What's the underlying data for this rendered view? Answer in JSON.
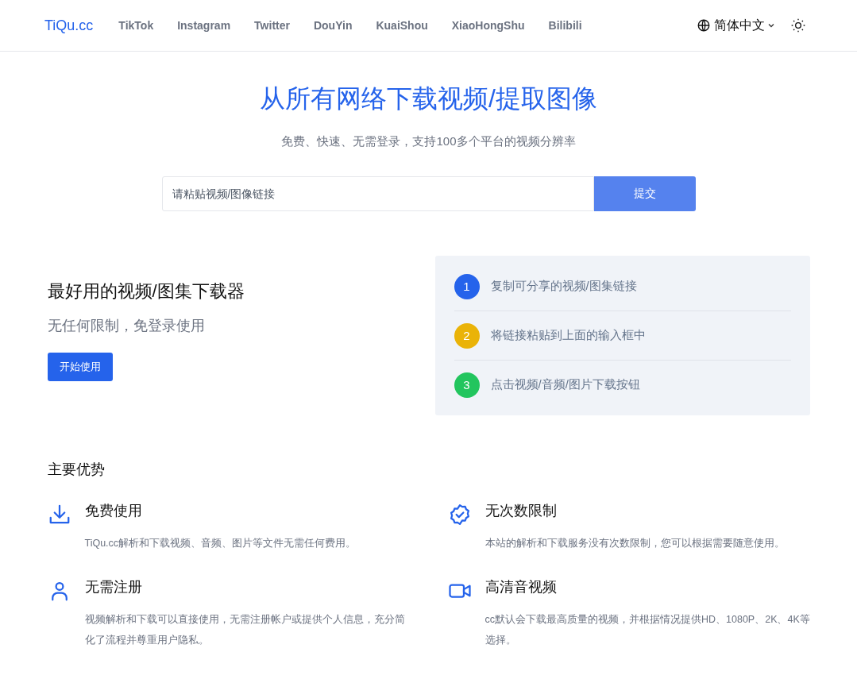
{
  "header": {
    "logo": "TiQu.cc",
    "nav": [
      "TikTok",
      "Instagram",
      "Twitter",
      "DouYin",
      "KuaiShou",
      "XiaoHongShu",
      "Bilibili"
    ],
    "language": "简体中文"
  },
  "hero": {
    "title": "从所有网络下载视频/提取图像",
    "subtitle": "免费、快速、无需登录，支持100多个平台的视频分辨率",
    "search": {
      "placeholder": "请粘贴视频/图像链接"
    },
    "submit": "提交"
  },
  "intro": {
    "title": "最好用的视频/图集下载器",
    "subtitle": "无任何限制，免登录使用",
    "button": "开始使用"
  },
  "steps": [
    {
      "number": "1",
      "text": "复制可分享的视频/图集链接",
      "color": "#2563eb"
    },
    {
      "number": "2",
      "text": "将链接粘贴到上面的输入框中",
      "color": "#eab308"
    },
    {
      "number": "3",
      "text": "点击视频/音频/图片下载按钮",
      "color": "#22c55e"
    }
  ],
  "advantages": {
    "title": "主要优势",
    "items": [
      {
        "kind": "download",
        "title": "免费使用",
        "text": "TiQu.cc解析和下载视频、音频、图片等文件无需任何费用。"
      },
      {
        "kind": "badge",
        "title": "无次数限制",
        "text": "本站的解析和下载服务没有次数限制，您可以根据需要随意使用。"
      },
      {
        "kind": "user",
        "title": "无需注册",
        "text": "视频解析和下载可以直接使用，无需注册帐户或提供个人信息，充分简化了流程并尊重用户隐私。"
      },
      {
        "kind": "video",
        "title": "高清音视频",
        "text": "cc默认会下载最高质量的视频，并根据情况提供HD、1080P、2K、4K等选择。"
      }
    ]
  }
}
